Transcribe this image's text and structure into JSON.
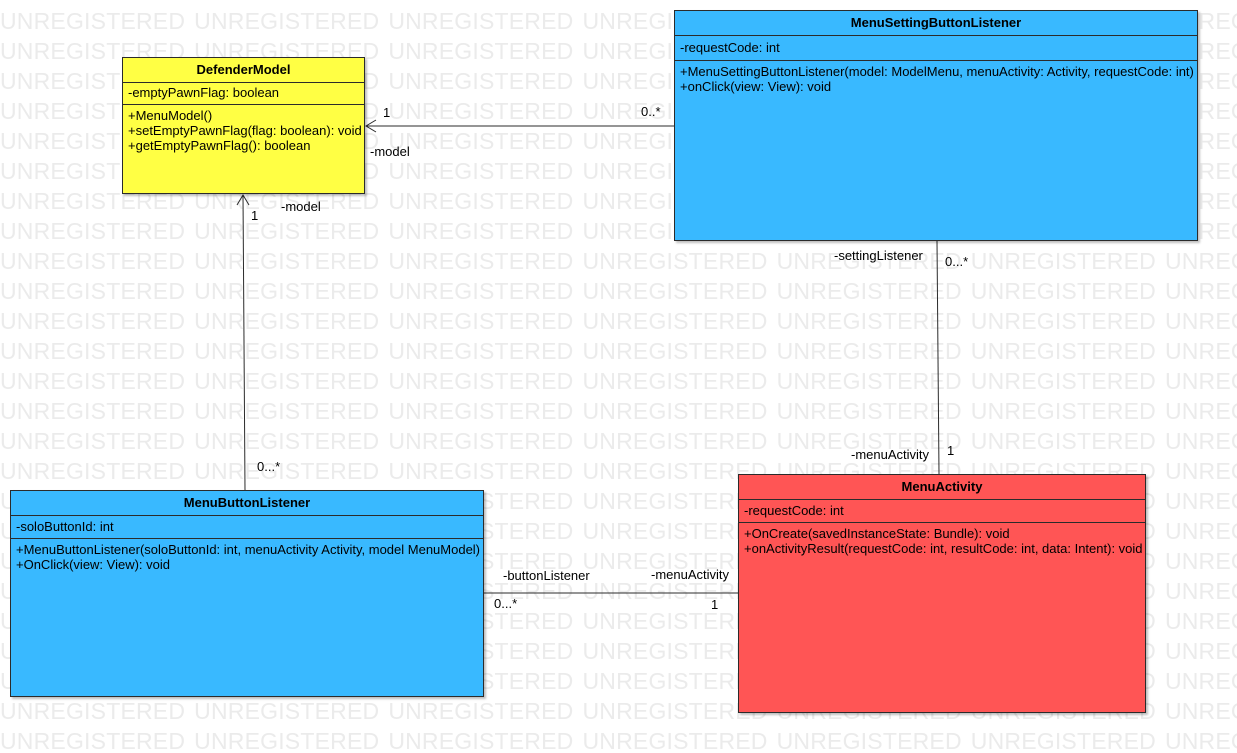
{
  "watermark": {
    "text": "UNREGISTERED"
  },
  "colors": {
    "model_fill": "#ffff44",
    "listener_fill": "#39b9ff",
    "activity_fill": "#ff5555",
    "border": "#2b2b2b",
    "watermark": "#ebebeb"
  },
  "classes": {
    "defender_model": {
      "name": "DefenderModel",
      "attributes": [
        "-emptyPawnFlag: boolean"
      ],
      "operations": [
        "+MenuModel()",
        "+setEmptyPawnFlag(flag: boolean): void",
        "+getEmptyPawnFlag(): boolean"
      ]
    },
    "menu_setting_button_listener": {
      "name": "MenuSettingButtonListener",
      "attributes": [
        "-requestCode: int"
      ],
      "operations": [
        "+MenuSettingButtonListener(model: ModelMenu, menuActivity: Activity, requestCode: int)",
        "+onClick(view: View): void"
      ]
    },
    "menu_button_listener": {
      "name": "MenuButtonListener",
      "attributes": [
        "-soloButtonId: int"
      ],
      "operations": [
        "+MenuButtonListener(soloButtonId: int, menuActivity Activity, model MenuModel)",
        "+OnClick(view: View): void"
      ]
    },
    "menu_activity": {
      "name": "MenuActivity",
      "attributes": [
        "-requestCode: int"
      ],
      "operations": [
        "+OnCreate(savedInstanceState: Bundle): void",
        "+onActivityResult(requestCode: int, resultCode: int, data: Intent): void"
      ]
    }
  },
  "associations": {
    "setting_to_model": {
      "target_multiplicity": "1",
      "source_multiplicity": "0..*",
      "role": "-model"
    },
    "button_to_model": {
      "target_multiplicity": "1",
      "role": "-model",
      "source_multiplicity": "0...*"
    },
    "setting_to_activity": {
      "setting_role": "-settingListener",
      "setting_multiplicity": "0...*",
      "activity_role": "-menuActivity",
      "activity_multiplicity": "1"
    },
    "button_to_activity": {
      "button_role": "-buttonListener",
      "button_multiplicity": "0...*",
      "activity_role": "-menuActivity",
      "activity_multiplicity": "1"
    }
  }
}
